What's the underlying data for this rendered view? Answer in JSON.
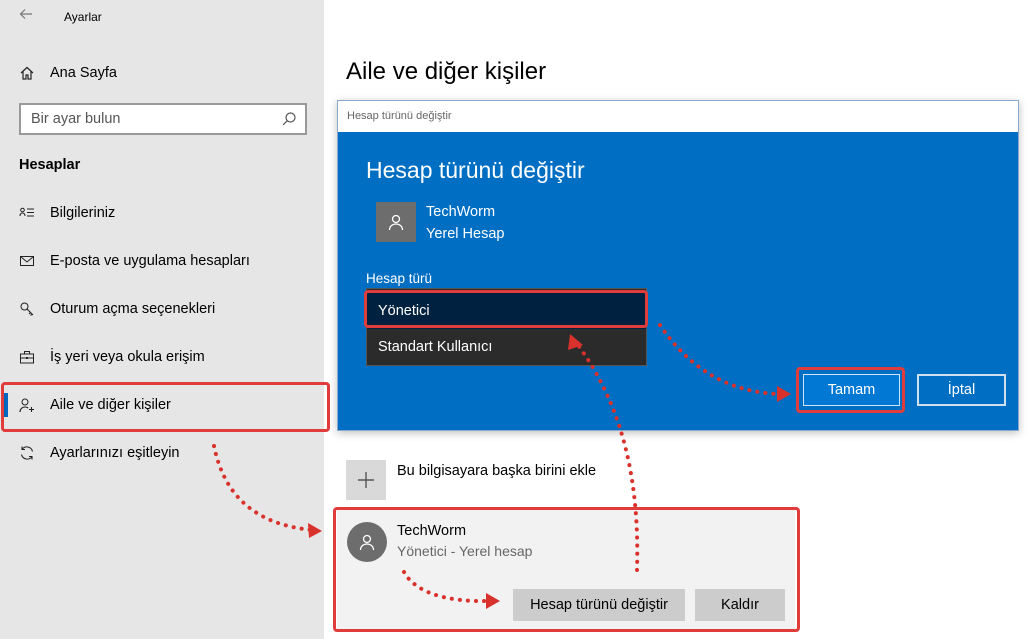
{
  "window": {
    "app_title": "Ayarlar",
    "back_icon": "arrow-left-icon"
  },
  "sidebar": {
    "home_label": "Ana Sayfa",
    "search_placeholder": "Bir ayar bulun",
    "section_title": "Hesaplar",
    "items": [
      {
        "label": "Bilgileriniz",
        "icon": "person-card-icon"
      },
      {
        "label": "E-posta ve uygulama hesapları",
        "icon": "mail-icon"
      },
      {
        "label": "Oturum açma seçenekleri",
        "icon": "key-icon"
      },
      {
        "label": "İş yeri veya okula erişim",
        "icon": "briefcase-icon"
      },
      {
        "label": "Aile ve diğer kişiler",
        "icon": "person-add-icon",
        "active": true
      },
      {
        "label": "Ayarlarınızı eşitleyin",
        "icon": "sync-icon"
      }
    ]
  },
  "main": {
    "page_title": "Aile ve diğer kişiler",
    "add_user_label": "Bu bilgisayara başka birini ekle"
  },
  "dialog": {
    "window_title": "Hesap türünü değiştir",
    "heading": "Hesap türünü değiştir",
    "user_name": "TechWorm",
    "user_type": "Yerel Hesap",
    "field_label": "Hesap türü",
    "options": [
      "Yönetici",
      "Standart Kullanıcı"
    ],
    "selected_option": "Yönetici",
    "ok_label": "Tamam",
    "cancel_label": "İptal"
  },
  "account_card": {
    "name": "TechWorm",
    "type": "Yönetici - Yerel hesap",
    "change_label": "Hesap türünü değiştir",
    "remove_label": "Kaldır"
  },
  "colors": {
    "accent": "#0078d4",
    "dialog_bg": "#006ec2",
    "highlight": "#e03c3c",
    "sidebar_bg": "#e6e6e6"
  }
}
